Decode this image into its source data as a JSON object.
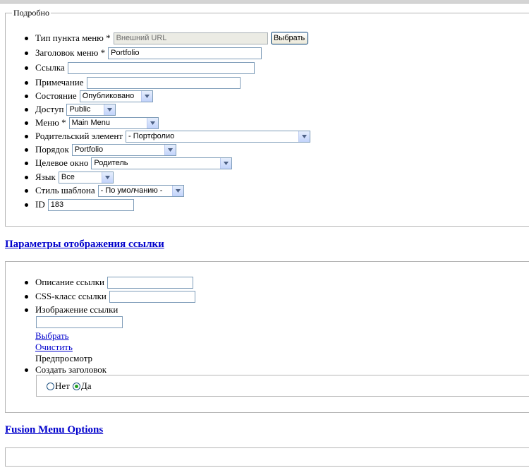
{
  "details": {
    "legend": "Подробно",
    "fields": {
      "type_label": "Тип пункта меню *",
      "type_value": "Внешний URL",
      "type_button": "Выбрать",
      "title_label": "Заголовок меню *",
      "title_value": "Portfolio",
      "link_label": "Ссылка",
      "link_value": "",
      "note_label": "Примечание",
      "note_value": "",
      "state_label": "Состояние",
      "state_value": "Опубликовано",
      "access_label": "Доступ",
      "access_value": "Public",
      "menu_label": "Меню *",
      "menu_value": "Main Menu",
      "parent_label": "Родительский элемент",
      "parent_value": "- Портфолио",
      "order_label": "Порядок",
      "order_value": "Portfolio",
      "target_label": "Целевое окно",
      "target_value": "Родитель",
      "lang_label": "Язык",
      "lang_value": "Все",
      "template_label": "Стиль шаблона",
      "template_value": "- По умолчанию -",
      "id_label": "ID",
      "id_value": "183"
    }
  },
  "link_options": {
    "heading": "Параметры отображения ссылки",
    "desc_label": "Описание ссылки",
    "desc_value": "",
    "css_label": "CSS-класс ссылки",
    "css_value": "",
    "image_label": "Изображение ссылки",
    "image_value": "",
    "select_link": "Выбрать",
    "clear_link": "Очистить",
    "preview_label": "Предпросмотр",
    "create_title_label": "Создать заголовок",
    "radio_no": "Нет",
    "radio_yes": "Да",
    "radio_selected": "yes"
  },
  "fusion": {
    "heading": "Fusion Menu Options"
  },
  "colors": {
    "link": "#0000cc",
    "input_border": "#7f9db9",
    "fieldset_border": "#b5b5b5",
    "radio_checked": "#21a121"
  }
}
